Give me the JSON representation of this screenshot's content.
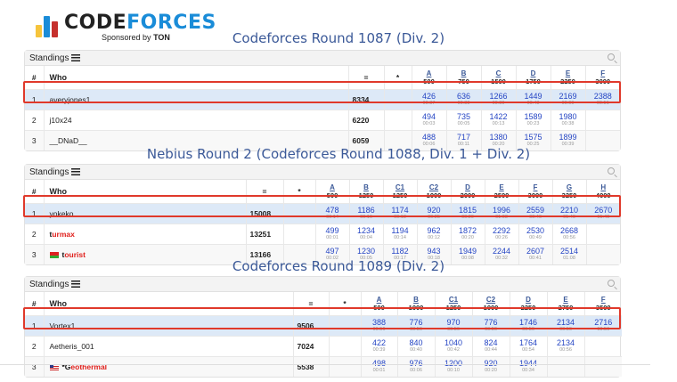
{
  "brand": {
    "name_part1": "CODE",
    "name_part2": "FORCES",
    "sponsored_prefix": "Sponsored by",
    "sponsor": "TON"
  },
  "panel_header": "Standings",
  "contests": [
    {
      "title": "Codeforces Round 1087 (Div. 2)",
      "columns": {
        "rank": "#",
        "who": "Who",
        "equals": "=",
        "star": "*"
      },
      "problems": [
        {
          "label": "A",
          "points": "500"
        },
        {
          "label": "B",
          "points": "750"
        },
        {
          "label": "C",
          "points": "1500"
        },
        {
          "label": "D",
          "points": "1750"
        },
        {
          "label": "E",
          "points": "2250"
        },
        {
          "label": "F",
          "points": "3000"
        }
      ],
      "rows": [
        {
          "rank": "1",
          "who": "averyjones1",
          "score": "8334",
          "cells": [
            {
              "v": "426",
              "t": "00:37"
            },
            {
              "v": "636",
              "t": "00:38"
            },
            {
              "v": "1266",
              "t": "00:39"
            },
            {
              "v": "1449",
              "t": "00:43"
            },
            {
              "v": "2169",
              "t": "00:09"
            },
            {
              "v": "2388",
              "t": "00:51"
            }
          ]
        },
        {
          "rank": "2",
          "who": "j10x24",
          "score": "6220",
          "cells": [
            {
              "v": "494",
              "t": "00:03"
            },
            {
              "v": "735",
              "t": "00:05"
            },
            {
              "v": "1422",
              "t": "00:13"
            },
            {
              "v": "1589",
              "t": "00:23"
            },
            {
              "v": "1980",
              "t": "00:38"
            },
            {
              "v": "",
              "t": ""
            }
          ]
        },
        {
          "rank": "3",
          "who": "__DNaD__",
          "score": "6059",
          "cells": [
            {
              "v": "488",
              "t": "00:06"
            },
            {
              "v": "717",
              "t": "00:11"
            },
            {
              "v": "1380",
              "t": "00:20"
            },
            {
              "v": "1575",
              "t": "00:25"
            },
            {
              "v": "1899",
              "t": "00:39"
            },
            {
              "v": "",
              "t": ""
            }
          ]
        }
      ]
    },
    {
      "title": "Nebius Round 2 (Codeforces Round 1088, Div. 1 + Div. 2)",
      "columns": {
        "rank": "#",
        "who": "Who",
        "equals": "=",
        "star": "*"
      },
      "problems": [
        {
          "label": "A",
          "points": "500"
        },
        {
          "label": "B",
          "points": "1250"
        },
        {
          "label": "C1",
          "points": "1250"
        },
        {
          "label": "C2",
          "points": "1000"
        },
        {
          "label": "D",
          "points": "2000"
        },
        {
          "label": "E",
          "points": "2500"
        },
        {
          "label": "F",
          "points": "3000"
        },
        {
          "label": "G",
          "points": "3250"
        },
        {
          "label": "H",
          "points": "4000"
        }
      ],
      "rows": [
        {
          "rank": "1",
          "who": "yokeko",
          "score": "15008",
          "cells": [
            {
              "v": "478",
              "t": "00:14"
            },
            {
              "v": "1186",
              "t": "00:16"
            },
            {
              "v": "1174",
              "t": "00:18"
            },
            {
              "v": "920",
              "t": "00:25"
            },
            {
              "v": "1815",
              "t": "00:29"
            },
            {
              "v": "1996",
              "t": "01:03"
            },
            {
              "v": "2559",
              "t": "00:46"
            },
            {
              "v": "2210",
              "t": "01:40"
            },
            {
              "v": "2670",
              "t": "01:40"
            }
          ]
        },
        {
          "rank": "2",
          "who_first": "t",
          "who_rest": "urmax",
          "score": "13251",
          "cells": [
            {
              "v": "499",
              "t": "00:01"
            },
            {
              "v": "1234",
              "t": "00:04"
            },
            {
              "v": "1194",
              "t": "00:14"
            },
            {
              "v": "962",
              "t": "00:12"
            },
            {
              "v": "1872",
              "t": "00:20"
            },
            {
              "v": "2292",
              "t": "00:26"
            },
            {
              "v": "2530",
              "t": "00:49"
            },
            {
              "v": "2668",
              "t": "00:56"
            },
            {
              "v": "",
              "t": ""
            }
          ]
        },
        {
          "rank": "3",
          "who_first": "t",
          "who_rest": "ourist",
          "score": "13166",
          "cells": [
            {
              "v": "497",
              "t": "00:02"
            },
            {
              "v": "1230",
              "t": "00:05"
            },
            {
              "v": "1182",
              "t": "00:17"
            },
            {
              "v": "943",
              "t": "00:18"
            },
            {
              "v": "1949",
              "t": "00:08"
            },
            {
              "v": "2244",
              "t": "00:32"
            },
            {
              "v": "2607",
              "t": "00:41"
            },
            {
              "v": "2514",
              "t": "01:08"
            },
            {
              "v": "",
              "t": ""
            }
          ]
        }
      ]
    },
    {
      "title": "Codeforces Round 1089 (Div. 2)",
      "columns": {
        "rank": "#",
        "who": "Who",
        "equals": "=",
        "star": "*"
      },
      "problems": [
        {
          "label": "A",
          "points": "500"
        },
        {
          "label": "B",
          "points": "1000"
        },
        {
          "label": "C1",
          "points": "1250"
        },
        {
          "label": "C2",
          "points": "1000"
        },
        {
          "label": "D",
          "points": "2250"
        },
        {
          "label": "E",
          "points": "2750"
        },
        {
          "label": "F",
          "points": "3500"
        }
      ],
      "rows": [
        {
          "rank": "1",
          "who": "Vortex1",
          "score": "9506",
          "cells": [
            {
              "v": "388",
              "t": "00:56"
            },
            {
              "v": "776",
              "t": "00:56"
            },
            {
              "v": "970",
              "t": "00:56"
            },
            {
              "v": "776",
              "t": "00:56"
            },
            {
              "v": "1746",
              "t": "00:56"
            },
            {
              "v": "2134",
              "t": "00:56"
            },
            {
              "v": "2716",
              "t": "00:56"
            }
          ]
        },
        {
          "rank": "2",
          "who": "Aetheris_001",
          "score": "7024",
          "cells": [
            {
              "v": "422",
              "t": "00:39"
            },
            {
              "v": "840",
              "t": "00:40"
            },
            {
              "v": "1040",
              "t": "00:42"
            },
            {
              "v": "824",
              "t": "00:44"
            },
            {
              "v": "1764",
              "t": "00:54"
            },
            {
              "v": "2134",
              "t": "00:56"
            },
            {
              "v": "",
              "t": ""
            }
          ]
        },
        {
          "rank": "3",
          "who_first": "*G",
          "who_rest": "eothermal",
          "score": "5538",
          "cells": [
            {
              "v": "498",
              "t": "00:01"
            },
            {
              "v": "976",
              "t": "00:06"
            },
            {
              "v": "1200",
              "t": "00:10"
            },
            {
              "v": "920",
              "t": "00:20"
            },
            {
              "v": "1944",
              "t": "00:34"
            },
            {
              "v": "",
              "t": ""
            },
            {
              "v": "",
              "t": ""
            }
          ]
        }
      ]
    }
  ],
  "colors": {
    "title_blue": "#3b5998",
    "score_blue": "#2545c4",
    "highlight_row": "#dde9f7",
    "highlight_border": "#e0392b",
    "red_rated": "#e0201c"
  }
}
